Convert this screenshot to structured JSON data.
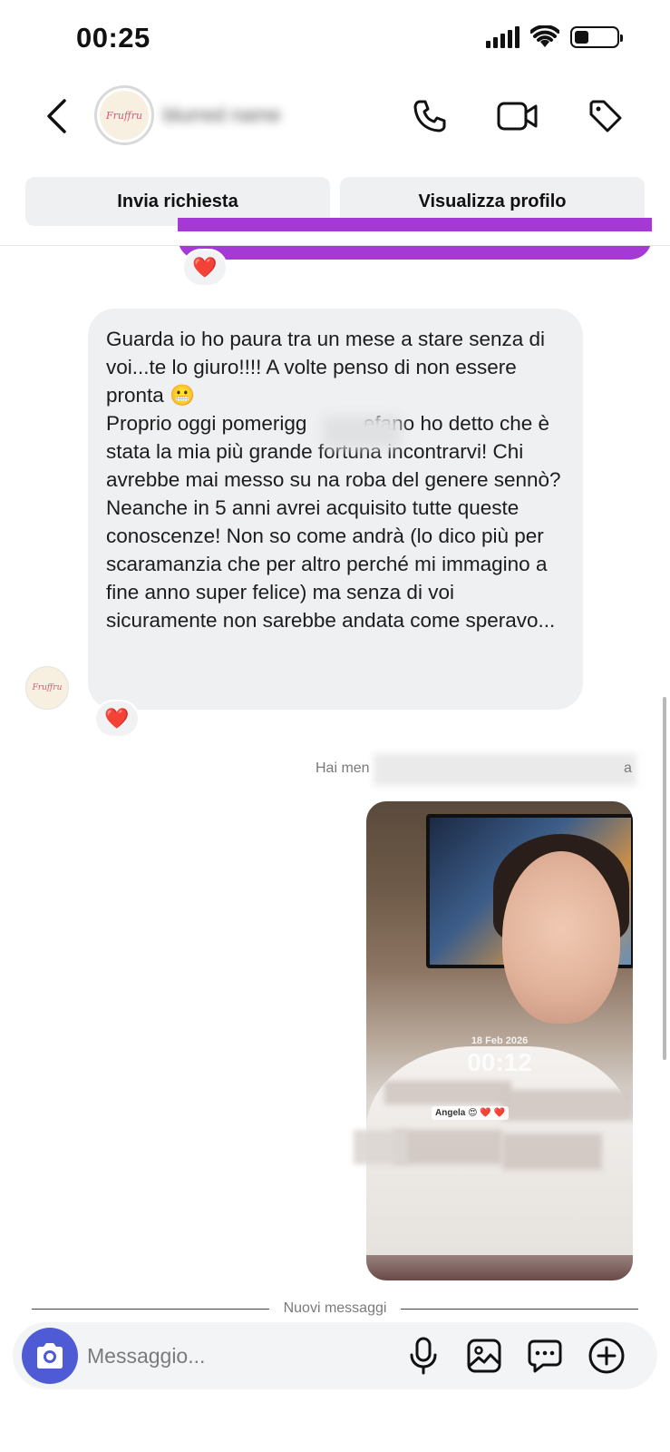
{
  "status_bar": {
    "time": "00:25"
  },
  "header": {
    "contact_name": "blurred name",
    "avatar_text": "Fruffru",
    "icons": [
      "back-icon",
      "phone-icon",
      "video-camera-icon",
      "tag-icon"
    ]
  },
  "actions": {
    "send_request_label": "Invia richiesta",
    "view_profile_label": "Visualizza profilo"
  },
  "messages": {
    "reaction_emoji": "❤️",
    "received_text": "Guarda io ho paura tra un mese a stare senza di voi...te lo giuro!!!! A volte penso di non essere pronta 😬\nProprio oggi pomerigg          efano ho detto che è stata la mia più grande fortuna incontrarvi! Chi avrebbe mai messo su na roba del genere sennò? Neanche in 5 anni avrei acquisito tutte queste conoscenze! Non so come andrà (lo dico più per scaramanzia che per altro perché mi immagino a fine anno super felice) ma senza di voi sicuramente non sarebbe andata come speravo...",
    "mention_notice": "Hai men",
    "mention_notice_end": "a"
  },
  "story": {
    "date": "18 Feb 2026",
    "clock": "00:12",
    "name_tag": "Angela 😍 ❤️ ❤️"
  },
  "new_messages_label": "Nuovi messaggi",
  "composer": {
    "placeholder": "Messaggio...",
    "accent_color": "#4f5bd5"
  },
  "colors": {
    "sent_bubble": "#a439d6",
    "received_bubble": "#eff0f2",
    "action_button": "#eef0f2"
  }
}
